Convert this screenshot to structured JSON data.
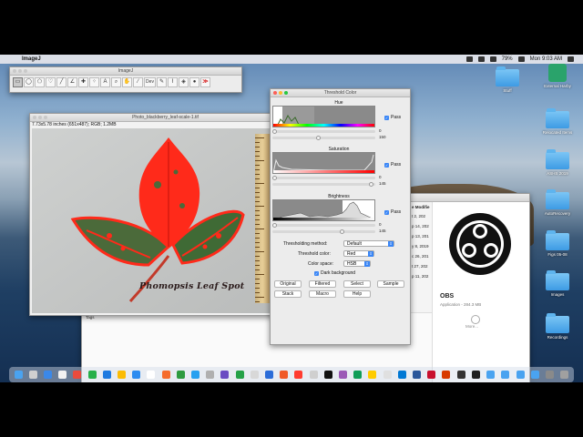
{
  "menubar": {
    "app_name": "ImageJ",
    "battery": "79%",
    "clock": "Mon 9:03 AM"
  },
  "toolbar_window": {
    "title": "ImageJ",
    "tools": [
      "rectangle",
      "oval",
      "polygon",
      "freehand",
      "line",
      "angle",
      "point",
      "wand",
      "text",
      "magnifier",
      "hand",
      "dropper",
      "Dev",
      "pencil",
      "brush",
      "flood-fill",
      "more"
    ],
    "dev_label": "Dev",
    "more_glyph": "≫"
  },
  "image_window": {
    "title": "Photo_blackberry_leaf-scale-1.tif",
    "info": "7.73x5.78 inches (651x487); RGB; 1.2MB",
    "caption": "Phomopsis Leaf Spot"
  },
  "threshold_window": {
    "title": "Threshold Color",
    "hue": {
      "label": "Hue",
      "min": "0",
      "max": "150",
      "pass_label": "Pass"
    },
    "saturation": {
      "label": "Saturation",
      "min": "0",
      "max": "145",
      "pass_label": "Pass"
    },
    "brightness": {
      "label": "Brightness",
      "min": "0",
      "max": "145",
      "pass_label": "Pass"
    },
    "thresholding_method_label": "Thresholding method:",
    "thresholding_method": "Default",
    "threshold_color_label": "Threshold color:",
    "threshold_color": "Red",
    "color_space_label": "Color space:",
    "color_space": "HSB",
    "dark_background_label": "Dark background",
    "buttons_row1": [
      "Original",
      "Filtered",
      "Select",
      "Sample"
    ],
    "buttons_row2": [
      "Stack",
      "Macro",
      "Help"
    ]
  },
  "finder_window": {
    "title": "Recordings",
    "column_header": "e Modifie",
    "dates": [
      "t 2, 202",
      "p 14, 202",
      "p 13, 201",
      "y 8, 2019",
      "c 26, 201",
      "t 27, 202",
      "p 11, 202"
    ],
    "tags_label": "Tags",
    "preview_name": "OBS",
    "preview_meta": "Application - 284.3 MB",
    "more_label": "More..."
  },
  "desktop_icons": [
    {
      "label": "Stuff"
    },
    {
      "label": "External Harby"
    },
    {
      "label": "Relocated Items"
    },
    {
      "label": "ASHS 2019"
    },
    {
      "label": "AutoRecovery"
    },
    {
      "label": "Figs 05-08"
    },
    {
      "label": "Images"
    },
    {
      "label": "Recordings"
    }
  ],
  "colors": {
    "threshold_red": "#ff2a1a",
    "accent_blue": "#3a86f6",
    "leaf_green": "#3f6a35"
  }
}
